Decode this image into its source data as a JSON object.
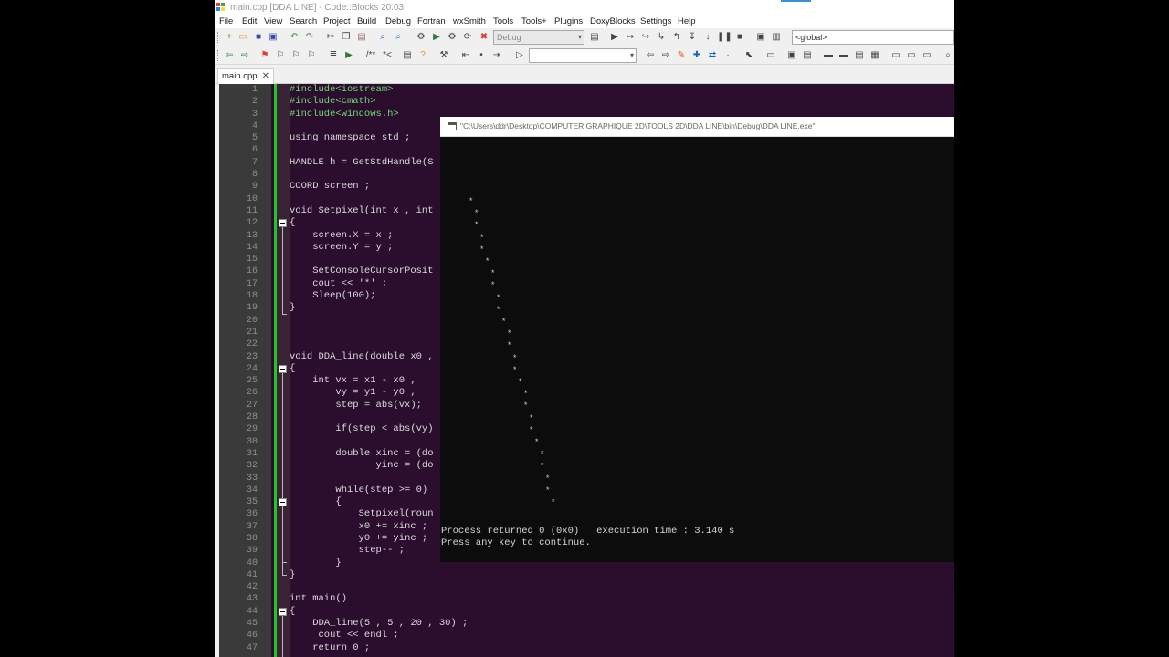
{
  "window": {
    "title": "main.cpp [DDA LINE] - Code::Blocks 20.03"
  },
  "menu": [
    "File",
    "Edit",
    "View",
    "Search",
    "Project",
    "Build",
    "Debug",
    "Fortran",
    "wxSmith",
    "Tools",
    "Tools+",
    "Plugins",
    "DoxyBlocks",
    "Settings",
    "Help"
  ],
  "toolbar": {
    "build_target": "Debug",
    "scope": "<global>",
    "symbol": ""
  },
  "tabs": [
    {
      "label": "main.cpp",
      "close": "✕"
    }
  ],
  "editor": {
    "line_numbers": [
      "1",
      "2",
      "3",
      "4",
      "5",
      "6",
      "7",
      "8",
      "9",
      "10",
      "11",
      "12",
      "13",
      "14",
      "15",
      "16",
      "17",
      "18",
      "19",
      "20",
      "21",
      "22",
      "23",
      "24",
      "25",
      "26",
      "27",
      "28",
      "29",
      "30",
      "31",
      "32",
      "33",
      "34",
      "35",
      "36",
      "37",
      "38",
      "39",
      "40",
      "41",
      "42",
      "43",
      "44",
      "45",
      "46",
      "47"
    ],
    "lines": [
      "#include<iostream>",
      "#include<cmath>",
      "#include<windows.h>",
      "",
      "using namespace std ;",
      "",
      "HANDLE h = GetStdHandle(S",
      "",
      "COORD screen ;",
      "",
      "void Setpixel(int x , int",
      "{",
      "    screen.X = x ;",
      "    screen.Y = y ;",
      "",
      "    SetConsoleCursorPosit",
      "    cout << '*' ;",
      "    Sleep(100);",
      "}",
      "",
      "",
      "",
      "void DDA_line(double x0 ,",
      "{",
      "    int vx = x1 - x0 ,",
      "        vy = y1 - y0 ,",
      "        step = abs(vx);",
      "",
      "        if(step < abs(vy)",
      "",
      "        double xinc = (do",
      "               yinc = (do",
      "",
      "        while(step >= 0)",
      "        {",
      "            Setpixel(roun",
      "            x0 += xinc ;",
      "            y0 += yinc ;",
      "            step-- ;",
      "        }",
      "}",
      "",
      "int main()",
      "{",
      "    DDA_line(5 , 5 , 20 , 30) ;",
      "     cout << endl ;",
      "    return 0 ;"
    ]
  },
  "console": {
    "title": "\"C:\\Users\\ddr\\Desktop\\COMPUTER GRAPHIQUE 2D\\TOOLS 2D\\DDA LINE\\bin\\Debug\\DDA LINE.exe\"",
    "star_char": "*",
    "plotted_points": [
      {
        "col": 5,
        "row": 5
      },
      {
        "col": 6,
        "row": 6
      },
      {
        "col": 6,
        "row": 7
      },
      {
        "col": 7,
        "row": 8
      },
      {
        "col": 7,
        "row": 9
      },
      {
        "col": 8,
        "row": 10
      },
      {
        "col": 9,
        "row": 11
      },
      {
        "col": 9,
        "row": 12
      },
      {
        "col": 10,
        "row": 13
      },
      {
        "col": 10,
        "row": 14
      },
      {
        "col": 11,
        "row": 15
      },
      {
        "col": 12,
        "row": 16
      },
      {
        "col": 12,
        "row": 17
      },
      {
        "col": 13,
        "row": 18
      },
      {
        "col": 13,
        "row": 19
      },
      {
        "col": 14,
        "row": 20
      },
      {
        "col": 15,
        "row": 21
      },
      {
        "col": 15,
        "row": 22
      },
      {
        "col": 16,
        "row": 23
      },
      {
        "col": 16,
        "row": 24
      },
      {
        "col": 17,
        "row": 25
      },
      {
        "col": 18,
        "row": 26
      },
      {
        "col": 18,
        "row": 27
      },
      {
        "col": 19,
        "row": 28
      },
      {
        "col": 19,
        "row": 29
      },
      {
        "col": 20,
        "row": 30
      }
    ],
    "output_lines": [
      "Process returned 0 (0x0)   execution time : 3.140 s",
      "Press any key to continue."
    ]
  }
}
